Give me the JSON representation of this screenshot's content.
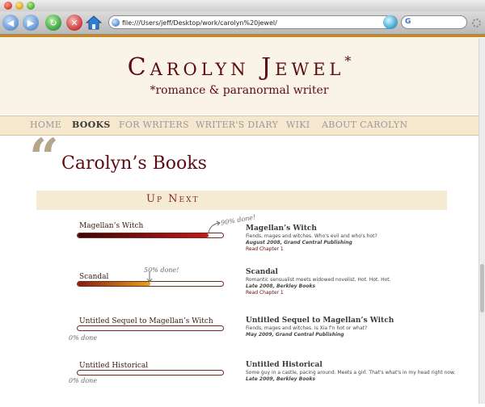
{
  "browser": {
    "url": "file:///Users/jeff/Desktop/work/carolyn%20jewel/",
    "search_value": "G"
  },
  "site": {
    "title": "Carolyn Jewel",
    "title_mark": "*",
    "tagline": "*romance & paranormal writer"
  },
  "nav": [
    {
      "label": "HOME",
      "active": false
    },
    {
      "label": "BOOKS",
      "active": true
    },
    {
      "label": "FOR WRITERS",
      "active": false
    },
    {
      "label": "WRITER'S DIARY",
      "active": false
    },
    {
      "label": "WIKI",
      "active": false
    },
    {
      "label": "ABOUT CAROLYN",
      "active": false
    }
  ],
  "page": {
    "quote_glyph": "“",
    "title": "Carolyn’s Books",
    "section_label": "Up Next"
  },
  "books": [
    {
      "bar_label": "Magellan’s Witch",
      "progress": 0.9,
      "progress_label": "90% done!",
      "title": "Magellan’s Witch",
      "desc": "Fiends, mages and witches. Who's evil and who's hot?",
      "pub": "August 2008, Grand Central Publishing",
      "link": "Read Chapter 1"
    },
    {
      "bar_label": "Scandal",
      "progress": 0.5,
      "progress_label": "50% done!",
      "title": "Scandal",
      "desc": "Romantic sensualist meets widowed novelist. Hot. Hot. Hot.",
      "pub": "Late 2008, Berkley Books",
      "link": "Read Chapter 1"
    },
    {
      "bar_label": "Untitled Sequel to Magellan’s Witch",
      "progress": 0,
      "progress_label": "0% done",
      "title": "Untitled Sequel to Magellan’s Witch",
      "desc": "Fiends, mages and witches. Is Xia f'n hot or what?",
      "pub": "May 2009, Grand Central Publishing",
      "link": ""
    },
    {
      "bar_label": "Untitled Historical",
      "progress": 0,
      "progress_label": "0% done",
      "title": "Untitled Historical",
      "desc": "Some guy in a castle, pacing around. Meets a girl. That's what's in my head right now.",
      "pub": "Late 2009, Berkley Books",
      "link": ""
    }
  ],
  "colors": {
    "accent": "#c78a1a",
    "brand": "#5c0c10",
    "header_bg": "#faf3e7",
    "nav_bg": "#f5e8cf",
    "fill_red_start": "#3a0608",
    "fill_red_end": "#c01a1a",
    "fill_gold_start": "#8a1a10",
    "fill_gold_end": "#e6a21a"
  },
  "icons": {
    "back": "back-arrow-icon",
    "forward": "forward-arrow-icon",
    "reload": "reload-icon",
    "stop": "stop-icon",
    "home": "home-icon",
    "url_globe": "globe-icon",
    "rss": "rss-icon",
    "go": "go-icon",
    "spinner": "activity-spinner-icon"
  }
}
